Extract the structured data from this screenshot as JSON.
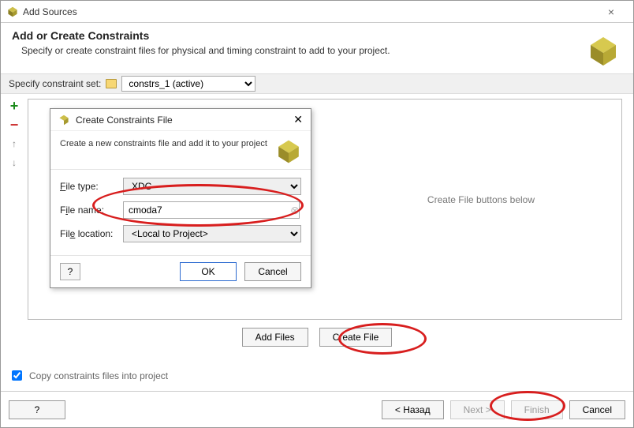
{
  "window": {
    "title": "Add Sources",
    "close_icon": "×"
  },
  "header": {
    "heading": "Add or Create Constraints",
    "description": "Specify or create constraint files for physical and timing constraint to add to your project."
  },
  "constraint_set": {
    "label": "Specify constraint set:",
    "value": "constrs_1 (active)"
  },
  "toolbar": {
    "add": "+",
    "remove": "−",
    "up": "↑",
    "down": "↓"
  },
  "list_hint_suffix": "Create File buttons below",
  "file_buttons": {
    "add_files": "Add Files",
    "create_file": "Create File"
  },
  "copy_label": "Copy constraints files into project",
  "footer": {
    "help": "?",
    "back": "< Назад",
    "next": "Next >",
    "finish": "Finish",
    "cancel": "Cancel"
  },
  "modal": {
    "title": "Create Constraints File",
    "subtitle": "Create a new constraints file and add it to your project",
    "file_type_label": "File type:",
    "file_type_value": "XDC",
    "file_name_label": "File name:",
    "file_name_value": "cmoda7",
    "file_location_label": "File location:",
    "file_location_value": "<Local to Project>",
    "ok": "OK",
    "cancel": "Cancel",
    "help": "?",
    "close": "✕"
  }
}
